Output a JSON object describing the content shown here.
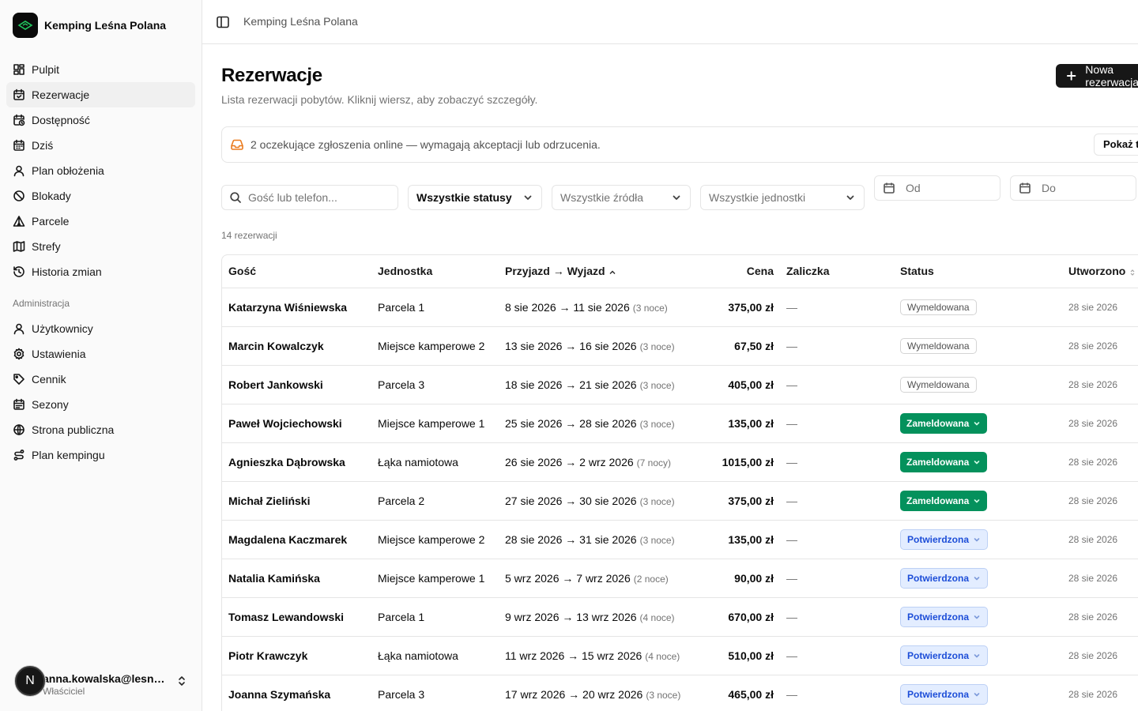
{
  "app": {
    "name": "Kemping Leśna Polana"
  },
  "sidebar": {
    "nav": [
      {
        "label": "Pulpit",
        "icon": "dashboard-icon"
      },
      {
        "label": "Rezerwacje",
        "icon": "calendar-check-icon",
        "active": true
      },
      {
        "label": "Dostępność",
        "icon": "calendar-clock-icon"
      },
      {
        "label": "Dziś",
        "icon": "calendar-icon"
      },
      {
        "label": "Plan obłożenia",
        "icon": "users-icon"
      },
      {
        "label": "Blokady",
        "icon": "ban-icon"
      },
      {
        "label": "Parcele",
        "icon": "tent-icon"
      },
      {
        "label": "Strefy",
        "icon": "map-icon"
      },
      {
        "label": "Historia zmian",
        "icon": "history-icon"
      }
    ],
    "admin_section": "Administracja",
    "admin_nav": [
      {
        "label": "Użytkownicy",
        "icon": "user-icon"
      },
      {
        "label": "Ustawienia",
        "icon": "gear-icon"
      },
      {
        "label": "Cennik",
        "icon": "tag-icon"
      },
      {
        "label": "Sezony",
        "icon": "calendar-range-icon"
      },
      {
        "label": "Strona publiczna",
        "icon": "globe-icon"
      },
      {
        "label": "Plan kempingu",
        "icon": "route-icon"
      }
    ],
    "user": {
      "initial": "N",
      "email": "anna.kowalska@lesnapolana.pl",
      "role": "Właściciel"
    }
  },
  "header": {
    "breadcrumb": "Kemping Leśna Polana"
  },
  "page": {
    "title": "Rezerwacje",
    "description": "Lista rezerwacji pobytów. Kliknij wiersz, aby zobaczyć szczegóły.",
    "new_button": "Nowa rezerwacja"
  },
  "alert": {
    "text": "2 oczekujące zgłoszenia online — wymagają akceptacji lub odrzucenia.",
    "button": "Pokaż tylko"
  },
  "filters": {
    "search_placeholder": "Gość lub telefon...",
    "status": "Wszystkie statusy",
    "source": "Wszystkie źródła",
    "unit": "Wszystkie jednostki",
    "from_placeholder": "Od",
    "to_placeholder": "Do"
  },
  "count_label": "14 rezerwacji",
  "table": {
    "columns": {
      "guest": "Gość",
      "unit": "Jednostka",
      "dates": "Przyjazd → Wyjazd",
      "price": "Cena",
      "deposit": "Zaliczka",
      "status": "Status",
      "created": "Utworzono"
    },
    "rows": [
      {
        "guest": "Katarzyna Wiśniewska",
        "unit": "Parcela 1",
        "dates": "8 sie 2026 → 11 sie 2026",
        "nights": "(3 noce)",
        "price": "375,00 zł",
        "deposit": "—",
        "status": "Wymeldowana",
        "status_kind": "out",
        "created": "28 sie 2026"
      },
      {
        "guest": "Marcin Kowalczyk",
        "unit": "Miejsce kamperowe 2",
        "dates": "13 sie 2026 → 16 sie 2026",
        "nights": "(3 noce)",
        "price": "67,50 zł",
        "deposit": "—",
        "status": "Wymeldowana",
        "status_kind": "out",
        "created": "28 sie 2026"
      },
      {
        "guest": "Robert Jankowski",
        "unit": "Parcela 3",
        "dates": "18 sie 2026 → 21 sie 2026",
        "nights": "(3 noce)",
        "price": "405,00 zł",
        "deposit": "—",
        "status": "Wymeldowana",
        "status_kind": "out",
        "created": "28 sie 2026"
      },
      {
        "guest": "Paweł Wojciechowski",
        "unit": "Miejsce kamperowe 1",
        "dates": "25 sie 2026 → 28 sie 2026",
        "nights": "(3 noce)",
        "price": "135,00 zł",
        "deposit": "—",
        "status": "Zameldowana",
        "status_kind": "in",
        "created": "28 sie 2026"
      },
      {
        "guest": "Agnieszka Dąbrowska",
        "unit": "Łąka namiotowa",
        "dates": "26 sie 2026 → 2 wrz 2026",
        "nights": "(7 nocy)",
        "price": "1015,00 zł",
        "deposit": "—",
        "status": "Zameldowana",
        "status_kind": "in",
        "created": "28 sie 2026"
      },
      {
        "guest": "Michał Zieliński",
        "unit": "Parcela 2",
        "dates": "27 sie 2026 → 30 sie 2026",
        "nights": "(3 noce)",
        "price": "375,00 zł",
        "deposit": "—",
        "status": "Zameldowana",
        "status_kind": "in",
        "created": "28 sie 2026"
      },
      {
        "guest": "Magdalena Kaczmarek",
        "unit": "Miejsce kamperowe 2",
        "dates": "28 sie 2026 → 31 sie 2026",
        "nights": "(3 noce)",
        "price": "135,00 zł",
        "deposit": "—",
        "status": "Potwierdzona",
        "status_kind": "conf",
        "created": "28 sie 2026"
      },
      {
        "guest": "Natalia Kamińska",
        "unit": "Miejsce kamperowe 1",
        "dates": "5 wrz 2026 → 7 wrz 2026",
        "nights": "(2 noce)",
        "price": "90,00 zł",
        "deposit": "—",
        "status": "Potwierdzona",
        "status_kind": "conf",
        "created": "28 sie 2026"
      },
      {
        "guest": "Tomasz Lewandowski",
        "unit": "Parcela 1",
        "dates": "9 wrz 2026 → 13 wrz 2026",
        "nights": "(4 noce)",
        "price": "670,00 zł",
        "deposit": "—",
        "status": "Potwierdzona",
        "status_kind": "conf",
        "created": "28 sie 2026"
      },
      {
        "guest": "Piotr Krawczyk",
        "unit": "Łąka namiotowa",
        "dates": "11 wrz 2026 → 15 wrz 2026",
        "nights": "(4 noce)",
        "price": "510,00 zł",
        "deposit": "—",
        "status": "Potwierdzona",
        "status_kind": "conf",
        "created": "28 sie 2026"
      },
      {
        "guest": "Joanna Szymańska",
        "unit": "Parcela 3",
        "dates": "17 wrz 2026 → 20 wrz 2026",
        "nights": "(3 noce)",
        "price": "465,00 zł",
        "deposit": "—",
        "status": "Potwierdzona",
        "status_kind": "conf",
        "created": "28 sie 2026"
      }
    ]
  },
  "colors": {
    "checked_in": "#04915c",
    "confirmed_bg": "#e3edff",
    "confirmed_text": "#1d4ed8",
    "alert_icon": "#ea7a1d"
  }
}
